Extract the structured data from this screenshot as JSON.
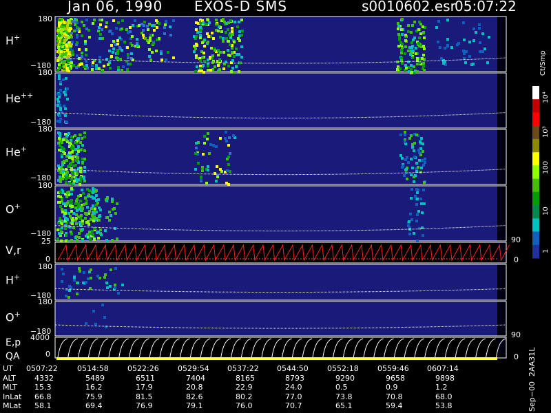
{
  "header": {
    "date": "Jan 06, 1990",
    "instrument": "EXOS-D SMS",
    "file": "s0010602.esr",
    "time": "05:07:22"
  },
  "panels": [
    {
      "id": "h1",
      "label": "H",
      "ion": "+",
      "ytop": "180",
      "ybot": "−180"
    },
    {
      "id": "he2",
      "label": "He",
      "ion": "++",
      "ytop": "180",
      "ybot": "−180"
    },
    {
      "id": "he1",
      "label": "He",
      "ion": "+",
      "ytop": "180",
      "ybot": "−180"
    },
    {
      "id": "o1",
      "label": "O",
      "ion": "+",
      "ytop": "180",
      "ybot": "−180"
    },
    {
      "id": "vr",
      "label": "V,r",
      "ion": "",
      "ytop": "25",
      "ybot": "0",
      "rtop": "90",
      "rbot": "0"
    },
    {
      "id": "h2",
      "label": "H",
      "ion": "+",
      "ytop": "180",
      "ybot": "−180"
    },
    {
      "id": "o2",
      "label": "O",
      "ion": "+",
      "ytop": "180",
      "ybot": "−180"
    },
    {
      "id": "ep",
      "label": "E,p",
      "label2": "QA",
      "ion": "",
      "ytop": "4000",
      "ybot": "0",
      "rtop": "90",
      "rbot": "0"
    }
  ],
  "colorbar": {
    "unit": "Ct/Smp",
    "ticks": [
      "10⁴",
      "10³",
      "100",
      "10",
      "1"
    ],
    "colors": [
      "#ffffff",
      "#c00000",
      "#ff0000",
      "#6a4a1a",
      "#8a8a00",
      "#ffff00",
      "#90ff00",
      "#40c000",
      "#00a000",
      "#008a50",
      "#00c0c0",
      "#1060c0",
      "#2030a0"
    ]
  },
  "footer_id": "Sep−00  2AA31L",
  "chart_data": {
    "type": "heatmap",
    "title": "Jan 06, 1990   EXOS-D SMS   s0010602.esr  05:07:22",
    "x_ticks_ut": [
      "0507:22",
      "0514:58",
      "0522:26",
      "0529:54",
      "0537:22",
      "0544:50",
      "0552:18",
      "0559:46",
      "0607:14"
    ],
    "rows": [
      {
        "name": "UT",
        "values": [
          "0507:22",
          "0514:58",
          "0522:26",
          "0529:54",
          "0537:22",
          "0544:50",
          "0552:18",
          "0559:46",
          "0607:14"
        ]
      },
      {
        "name": "ALT",
        "values": [
          "4332",
          "5489",
          "6511",
          "7404",
          "8165",
          "8793",
          "9290",
          "9658",
          "9898"
        ]
      },
      {
        "name": "MLT",
        "values": [
          "15.3",
          "16.2",
          "17.9",
          "20.8",
          "22.9",
          "24.0",
          "0.5",
          "0.9",
          "1.2"
        ]
      },
      {
        "name": "InLat",
        "values": [
          "66.8",
          "75.9",
          "81.5",
          "82.6",
          "80.2",
          "77.0",
          "73.8",
          "70.8",
          "68.0"
        ]
      },
      {
        "name": "MLat",
        "values": [
          "58.1",
          "69.4",
          "76.9",
          "79.1",
          "76.0",
          "70.7",
          "65.1",
          "59.4",
          "53.8"
        ]
      }
    ],
    "y_range_pitch": [
      -180,
      180
    ],
    "v_range": [
      0,
      25
    ],
    "e_range": [
      0,
      4000
    ],
    "colorbar_range": [
      1,
      10000
    ],
    "colorbar_scale": "log"
  }
}
